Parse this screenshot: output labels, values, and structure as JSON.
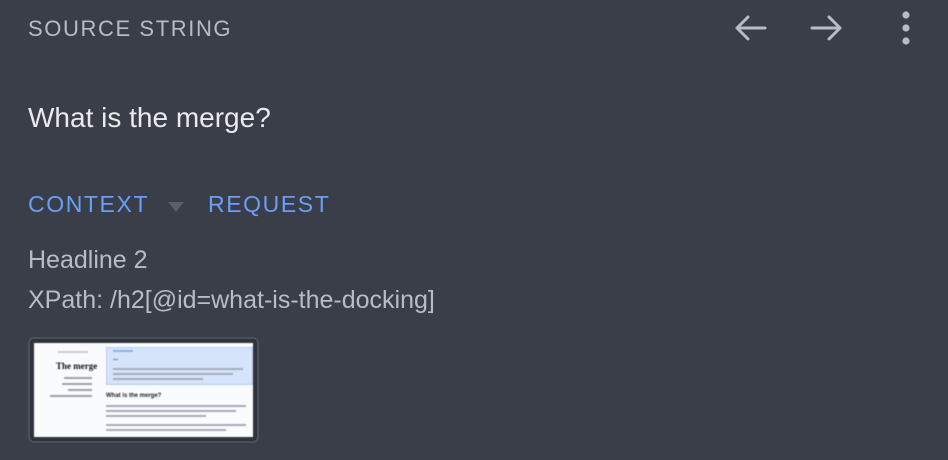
{
  "header": {
    "title": "SOURCE STRING",
    "icons": [
      "arrow-left-icon",
      "arrow-right-icon",
      "more-vertical-icon"
    ]
  },
  "source_text": "What is the merge?",
  "tabs": {
    "context_label": "CONTEXT",
    "request_label": "REQUEST"
  },
  "context": {
    "element_type": "Headline 2",
    "xpath": "XPath: /h2[@id=what-is-the-docking]"
  },
  "screenshot_thumbnail": {
    "page_title": "The merge",
    "banner_title": "...",
    "section_heading": "What is the merge?"
  },
  "colors": {
    "background": "#3a3e48",
    "muted_text": "#b7bcc6",
    "primary_text": "#e8eaee",
    "accent": "#6a9ef8"
  }
}
